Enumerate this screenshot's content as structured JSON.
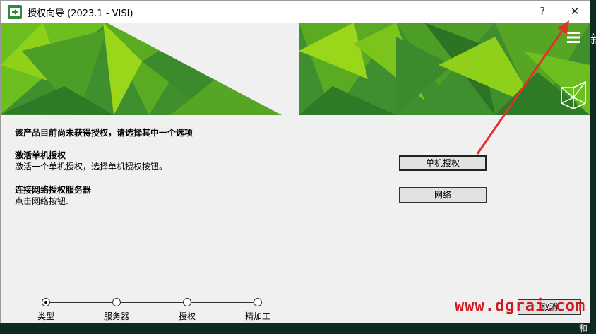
{
  "window": {
    "title": "授权向导 (2023.1 - VISI)",
    "help_label": "?",
    "close_label": "✕"
  },
  "banner": {
    "menu_icon": "hamburger-menu-icon",
    "logo_icon": "hexagon-logo-icon"
  },
  "left_panel": {
    "header": "该产品目前尚未获得授权，请选择其中一个选项",
    "option1_title": "激活单机授权",
    "option1_desc": "激活一个单机授权，选择单机授权按钮。",
    "option2_title": "连接网络授权服务器",
    "option2_desc": "点击网络按钮."
  },
  "buttons": {
    "standalone": "单机授权",
    "network": "网络",
    "cancel": "取消"
  },
  "steps": [
    {
      "label": "类型",
      "active": true
    },
    {
      "label": "服务器",
      "active": false
    },
    {
      "label": "授权",
      "active": false
    },
    {
      "label": "精加工",
      "active": false
    }
  ],
  "watermark": "www.dgrai.com",
  "backdrop": {
    "right_glyph": "新",
    "bottom_right": "和"
  },
  "colors": {
    "banner_green": "#3f8f2f",
    "accent_lime": "#9ad61a",
    "arrow_red": "#e0312f"
  }
}
